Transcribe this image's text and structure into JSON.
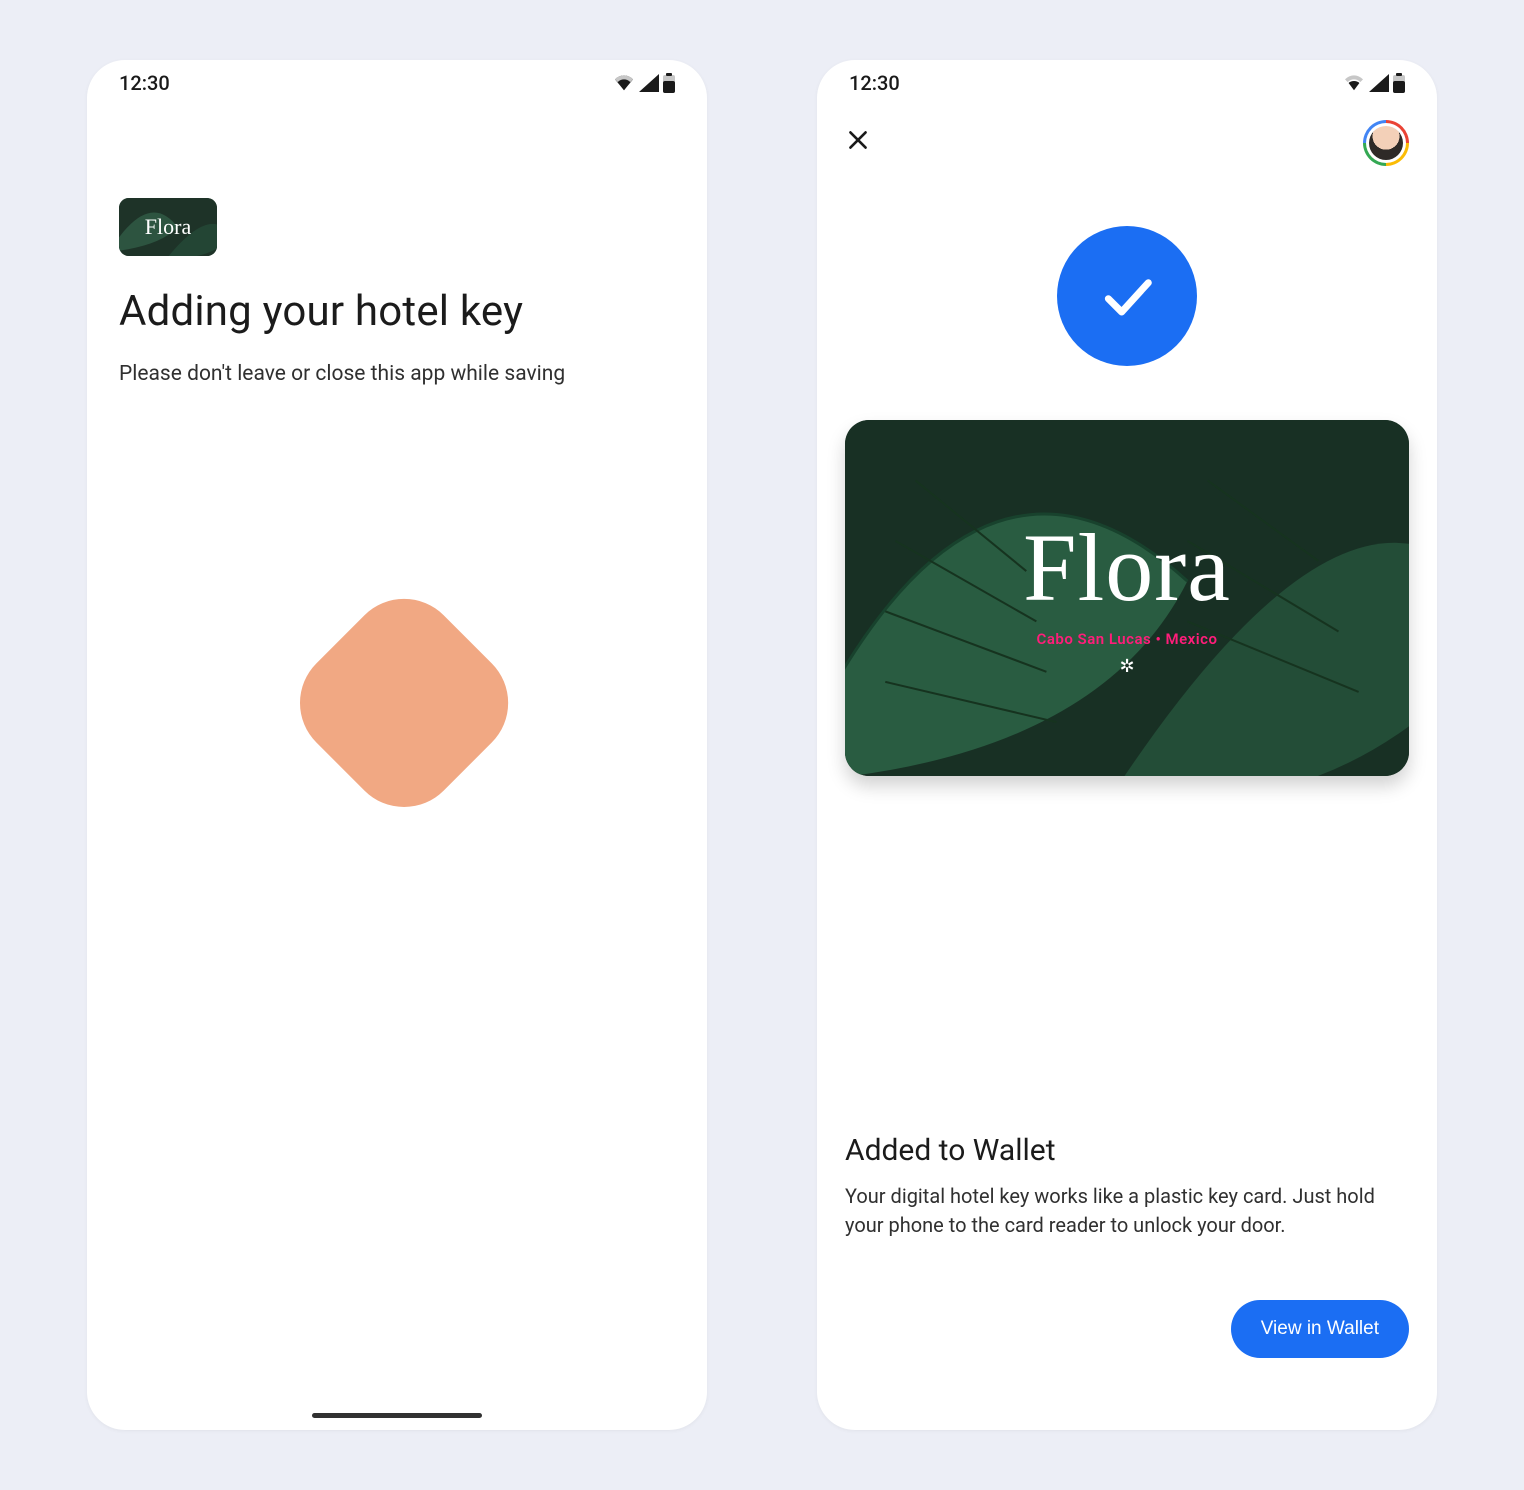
{
  "statusbar": {
    "time": "12:30"
  },
  "left": {
    "brand_mini": "Flora",
    "headline": "Adding your hotel key",
    "subtext": "Please don't leave or close this app while saving"
  },
  "right": {
    "card": {
      "brand": "Flora",
      "location": "Cabo San Lucas  •  Mexico"
    },
    "added_title": "Added to Wallet",
    "added_body": "Your digital hotel key works like a plastic key card. Just hold your phone to the card reader to unlock your door.",
    "cta": "View in Wallet"
  }
}
